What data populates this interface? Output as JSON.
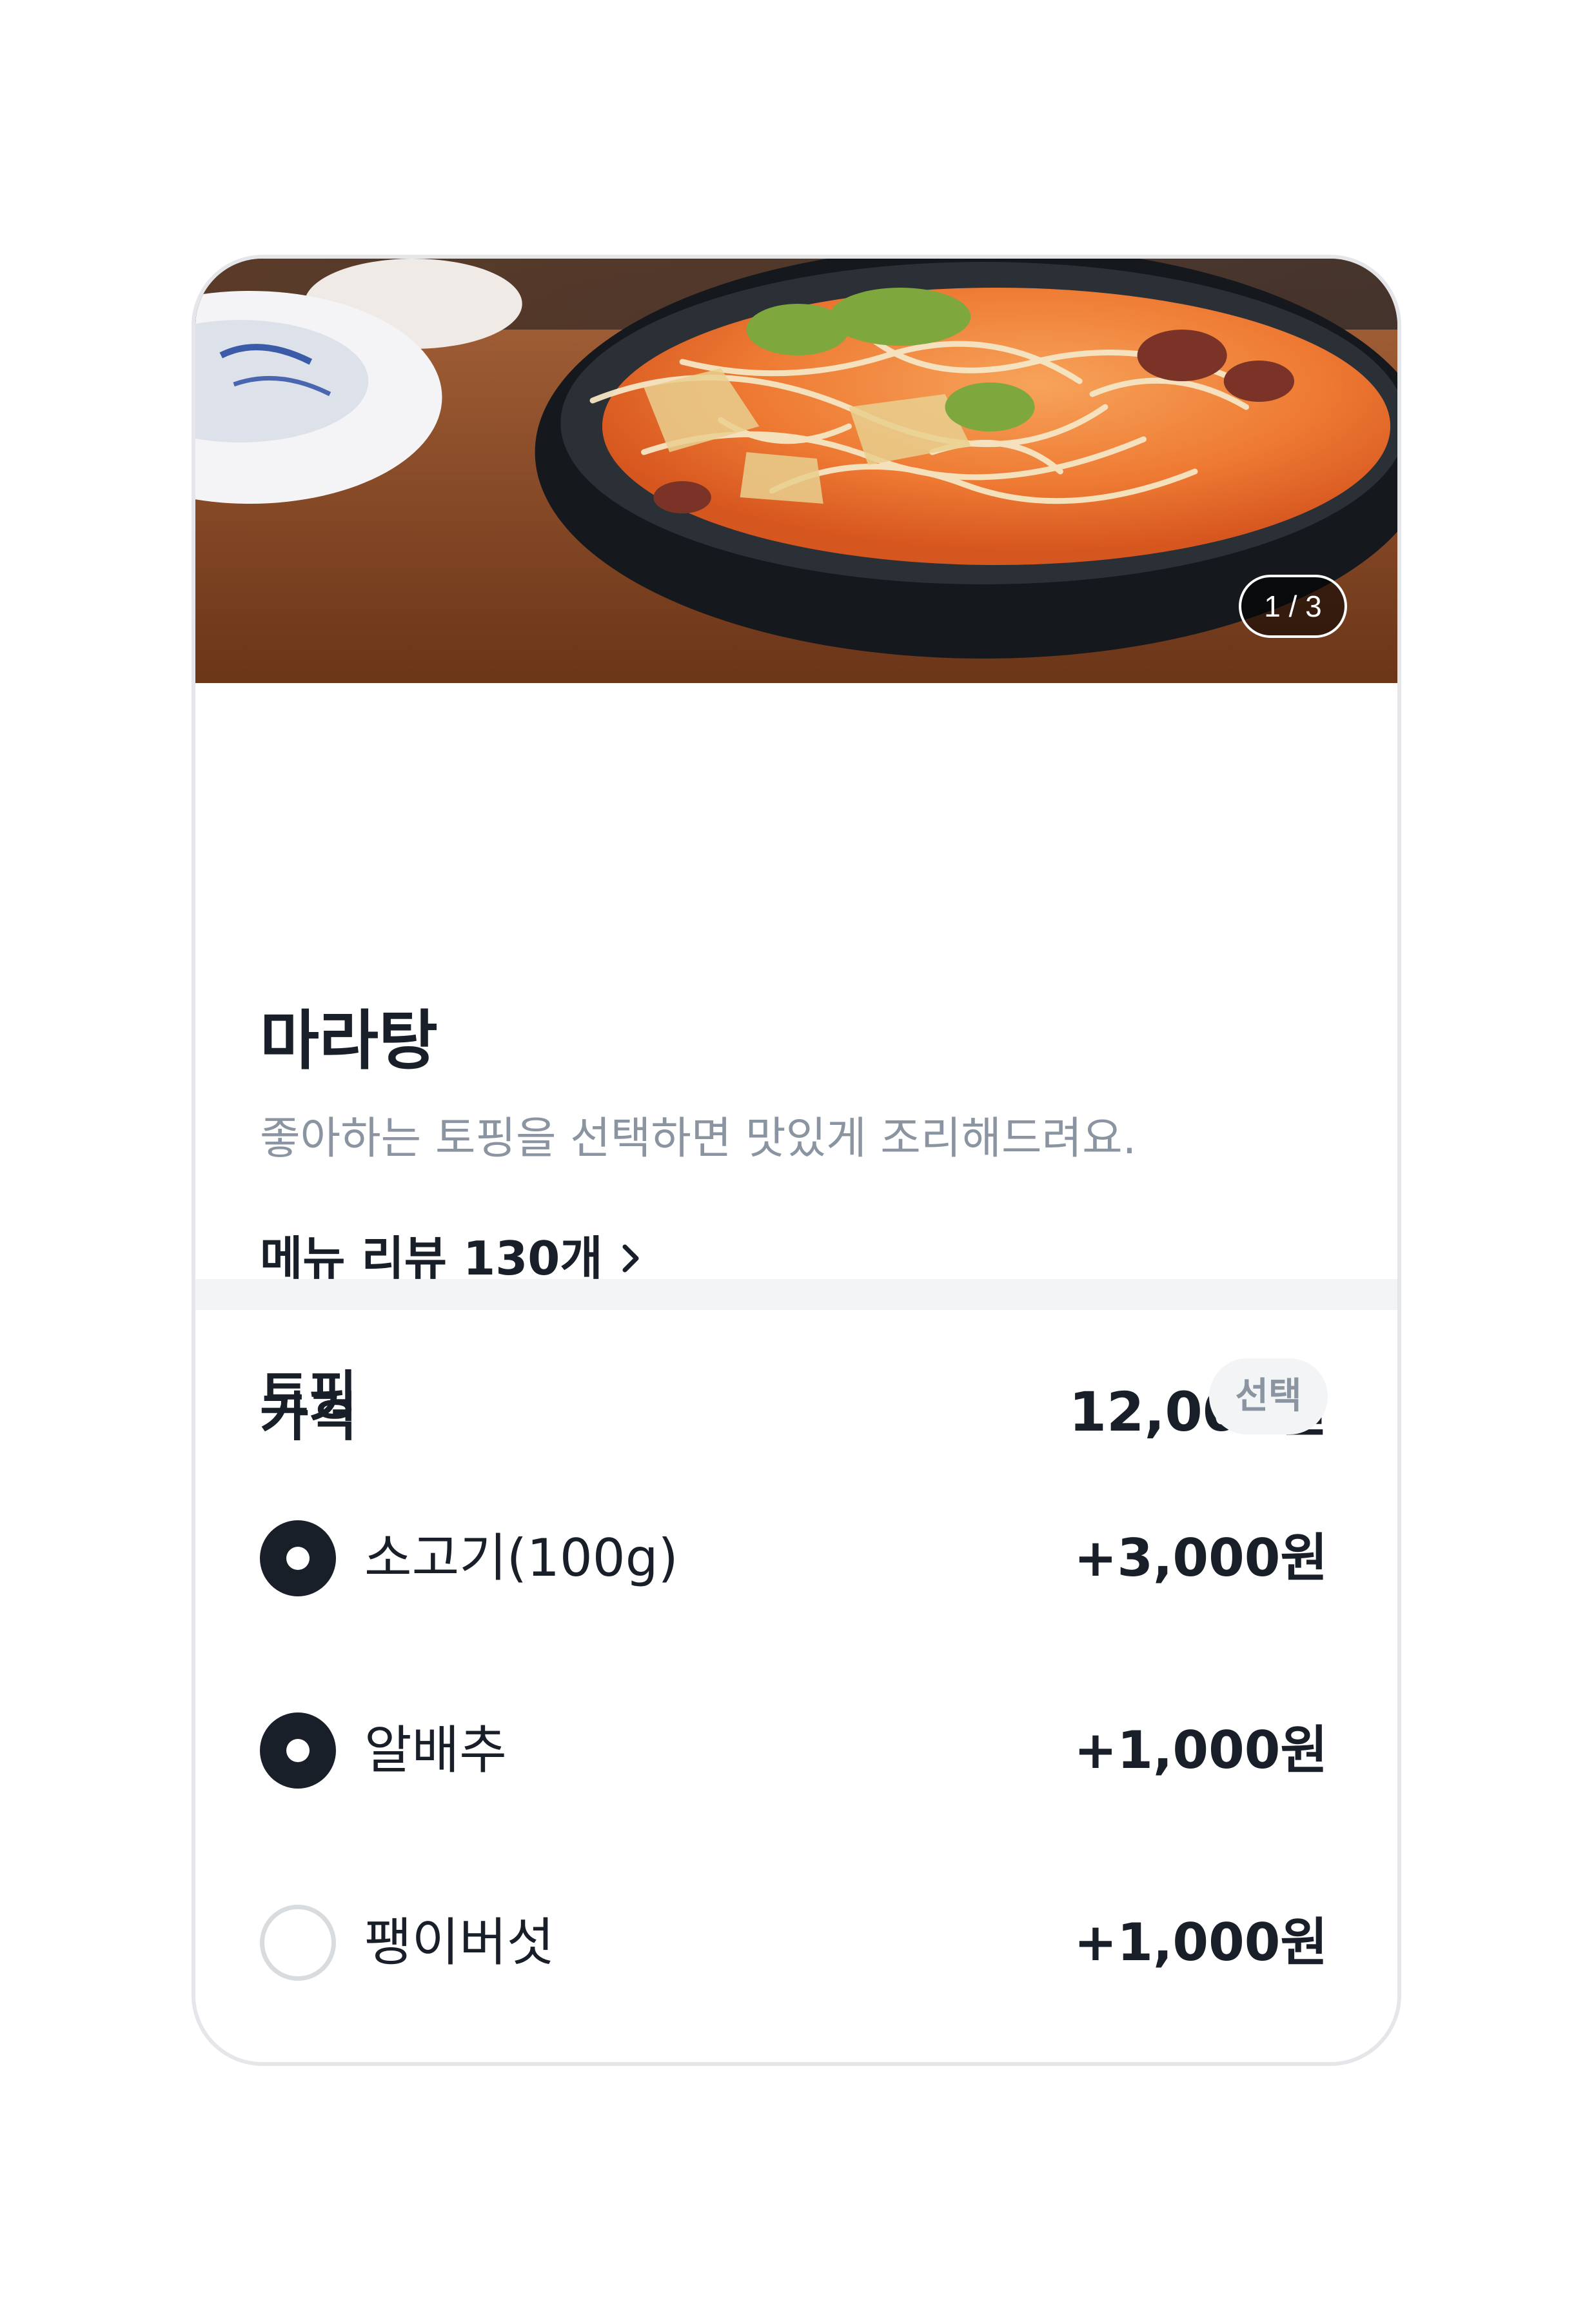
{
  "hero": {
    "page_indicator": "1 / 3",
    "image_icon": "mala-soup-photo"
  },
  "menu": {
    "title": "마라탕",
    "description": "좋아하는 토핑을 선택하면 맛있게 조리해드려요.",
    "review_link": "메뉴 리뷰 130개",
    "review_icon": "chevron-right-icon"
  },
  "price": {
    "label": "가격",
    "value": "12,000원"
  },
  "toppings": {
    "title": "토핑",
    "badge": "선택",
    "options": [
      {
        "name": "소고기(100g)",
        "price": "+3,000원",
        "selected": true
      },
      {
        "name": "알배추",
        "price": "+1,000원",
        "selected": true
      },
      {
        "name": "팽이버섯",
        "price": "+1,000원",
        "selected": false
      }
    ]
  },
  "colors": {
    "text_primary": "#191f28",
    "text_secondary": "#8b95a1",
    "divider": "#f2f4f6",
    "card_border": "#e4e6e9"
  }
}
